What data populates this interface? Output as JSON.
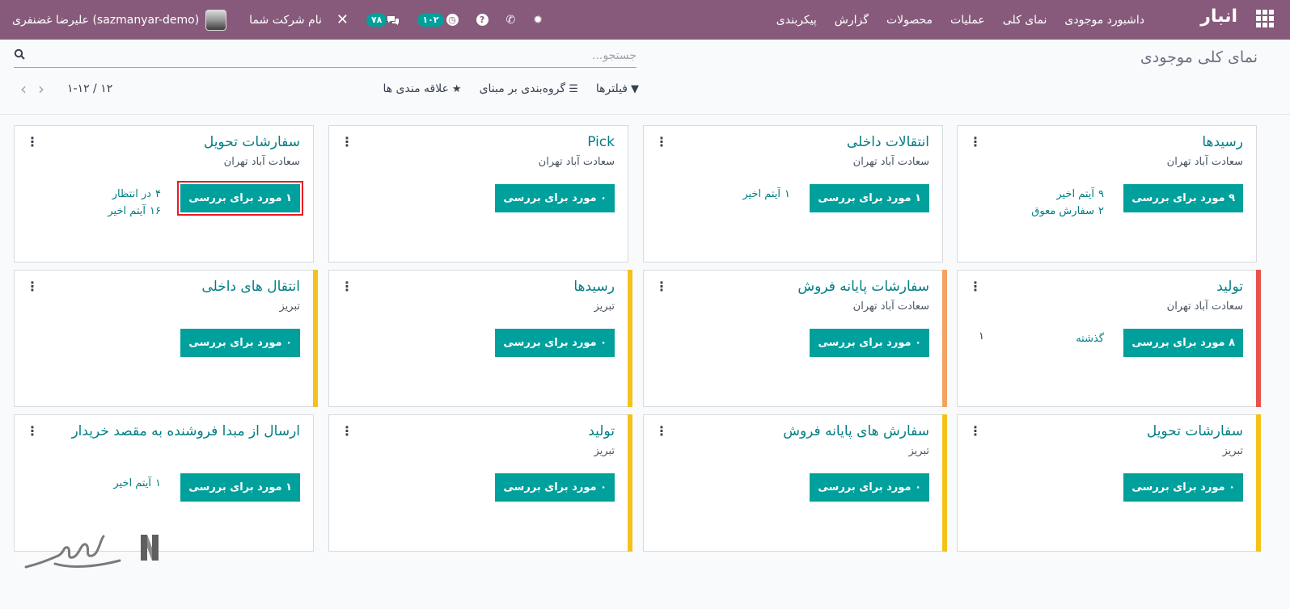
{
  "navbar": {
    "app_name": "انبار",
    "menu": [
      "داشبورد موجودی",
      "نمای کلی",
      "عملیات",
      "محصولات",
      "گزارش",
      "پیکربندی"
    ],
    "user_name": "علیرضا غضنفری (sazmanyar-demo)",
    "company": "نام شرکت شما",
    "chat_count": "۷۸",
    "activity_count": "۱۰۲",
    "bg_color": "#875a7b"
  },
  "control_panel": {
    "title": "نمای کلی موجودی",
    "search_placeholder": "جستجو...",
    "filters_label": "فیلترها",
    "groupby_label": "گروه‌بندی بر مبنای",
    "favorites_label": "علاقه مندی ها",
    "pager": "۱-۱۲ / ۱۲"
  },
  "cards": [
    {
      "title": "رسیدها",
      "subtitle": "سعادت آباد تهران",
      "button": "۹ مورد برای بررسی",
      "stats": [
        [
          "۹",
          "آیتم اخیر"
        ],
        [
          "۲",
          "سفارش معوق"
        ]
      ],
      "strip": ""
    },
    {
      "title": "انتقالات داخلی",
      "subtitle": "سعادت آباد تهران",
      "button": "۱ مورد برای بررسی",
      "stats": [
        [
          "۱",
          "آیتم اخیر"
        ]
      ],
      "strip": ""
    },
    {
      "title": "Pick",
      "subtitle": "سعادت آباد تهران",
      "button": "۰ مورد برای بررسی",
      "stats": [],
      "strip": ""
    },
    {
      "title": "سفارشات تحویل",
      "subtitle": "سعادت آباد تهران",
      "button": "۱ مورد برای بررسی",
      "stats": [
        [
          "۴",
          "در انتظار"
        ],
        [
          "۱۶",
          "آیتم اخیر"
        ]
      ],
      "strip": "",
      "highlight": true
    },
    {
      "title": "تولید",
      "subtitle": "سعادت آباد تهران",
      "button": "۸ مورد برای بررسی",
      "late_label": "گذشته",
      "late_count": "۱",
      "stats": [],
      "strip": "#e8524a"
    },
    {
      "title": "سفارشات پایانه فروش",
      "subtitle": "سعادت آباد تهران",
      "button": "۰ مورد برای بررسی",
      "stats": [],
      "strip": "#f4a261"
    },
    {
      "title": "رسیدها",
      "subtitle": "تبریز",
      "button": "۰ مورد برای بررسی",
      "stats": [],
      "strip": "#f4c21b"
    },
    {
      "title": "انتقال های داخلی",
      "subtitle": "تبریز",
      "button": "۰ مورد برای بررسی",
      "stats": [],
      "strip": "#f4c21b"
    },
    {
      "title": "سفارشات تحویل",
      "subtitle": "تبریز",
      "button": "۰ مورد برای بررسی",
      "stats": [],
      "strip": "#f4c21b"
    },
    {
      "title": "سفارش های پایانه فروش",
      "subtitle": "تبریز",
      "button": "۰ مورد برای بررسی",
      "stats": [],
      "strip": "#f4c21b"
    },
    {
      "title": "تولید",
      "subtitle": "تبریز",
      "button": "۰ مورد برای بررسی",
      "stats": [],
      "strip": "#f4c21b"
    },
    {
      "title": "ارسال از مبدا فروشنده به مقصد خریدار",
      "subtitle": "",
      "button": "۱ مورد برای بررسی",
      "stats": [
        [
          "۱",
          "آیتم اخیر"
        ]
      ],
      "strip": ""
    }
  ],
  "colors": {
    "accent": "#00a09d",
    "title": "#017e84",
    "highlight": "#e81a24"
  }
}
